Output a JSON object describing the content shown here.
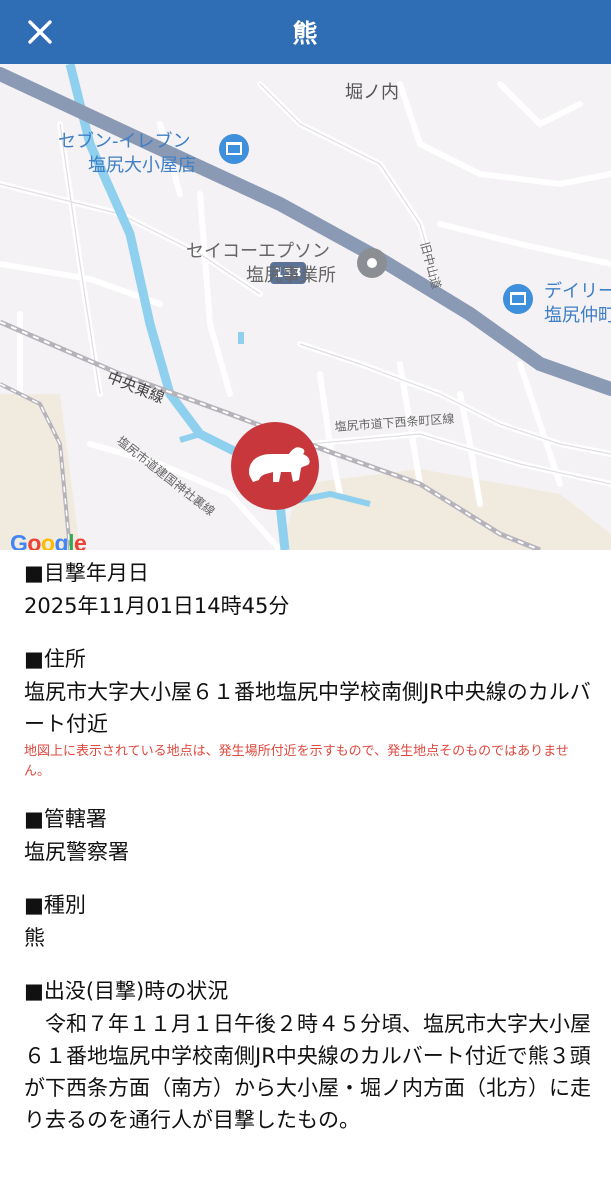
{
  "header": {
    "title": "熊",
    "close_icon": "close-icon"
  },
  "map": {
    "labels": {
      "horinouchi": "堀ノ内",
      "seven_eleven_1": "セブン-イレブン",
      "seven_eleven_2": "塩尻大小屋店",
      "route": "153",
      "seiko_1": "セイコーエプソン",
      "seiko_2": "塩尻事業所",
      "kyunakasen": "旧中山道",
      "daily_1": "デイリー",
      "daily_2": "塩尻仲町",
      "chuo_line": "中央東線",
      "road_shimonishijo": "塩尻市道下西条町区線",
      "road_kenkoku": "塩尻市道建国神社裏線"
    },
    "marker_icon": "bear-icon",
    "google": [
      "G",
      "o",
      "o",
      "g",
      "l",
      "e"
    ],
    "colors": {
      "water": "#8fd0ee",
      "highway": "#8a9ab4",
      "marker": "#c8373c",
      "poi_blue": "#3e8fdc"
    }
  },
  "details": {
    "date_heading": "■目撃年月日",
    "date_value": "2025年11月01日14時45分",
    "address_heading": "■住所",
    "address_value": "塩尻市大字大小屋６１番地塩尻中学校南側JR中央線のカルバート付近",
    "address_note": "地図上に表示されている地点は、発生場所付近を示すもので、発生地点そのものではありません。",
    "station_heading": "■管轄署",
    "station_value": "塩尻警察署",
    "type_heading": "■種別",
    "type_value": "熊",
    "situation_heading": "■出没(目撃)時の状況",
    "situation_value": "　令和７年１１月１日午後２時４５分頃、塩尻市大字大小屋６１番地塩尻中学校南側JR中央線のカルバート付近で熊３頭が下西条方面（南方）から大小屋・堀ノ内方面（北方）に走り去るのを通行人が目撃したもの。"
  }
}
